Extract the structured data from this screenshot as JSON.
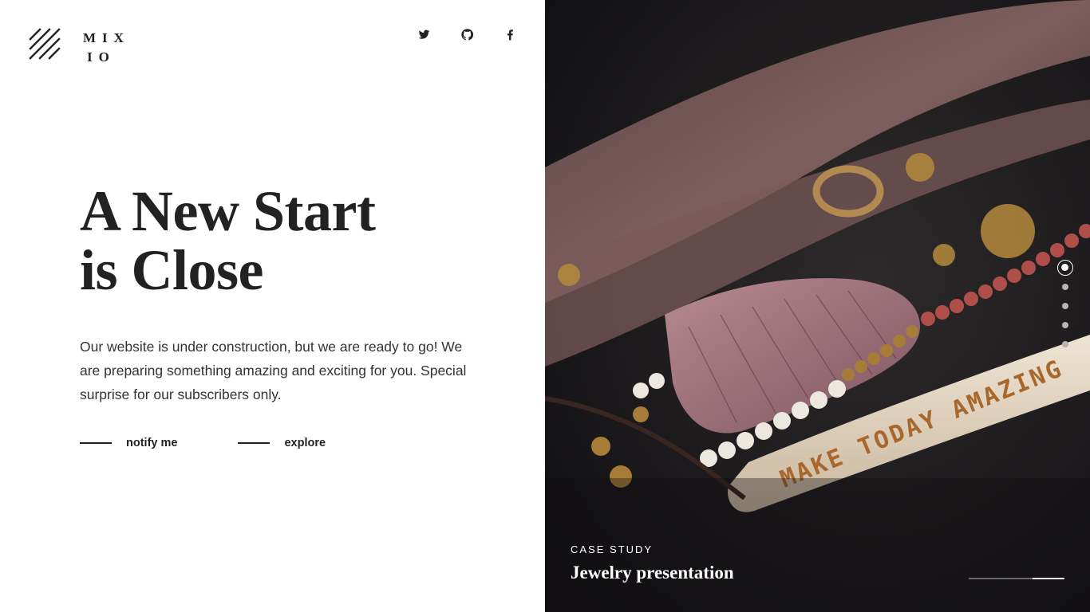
{
  "brand": {
    "logo_line1": "MIX",
    "logo_line2": "IO"
  },
  "social": [
    {
      "icon": "twitter-icon"
    },
    {
      "icon": "github-icon"
    },
    {
      "icon": "facebook-icon"
    }
  ],
  "hero": {
    "headline_line1": "A New Start",
    "headline_line2": "is Close",
    "description": "Our website is under construction, but we are ready to go! We are preparing something amazing and exciting for you. Special surprise for our subscribers only."
  },
  "actions": {
    "notify_label": "notify me",
    "explore_label": "explore"
  },
  "slider": {
    "kicker": "CASE STUDY",
    "title": "Jewelry presentation",
    "slide_count": 5,
    "active_slide": 1,
    "progress_fraction": 0.33,
    "engraving": "MAKE TODAY AMAZING"
  },
  "colors": {
    "text_dark": "#222222",
    "panel_dark": "#1b1a1c",
    "accent_white": "#ffffff"
  }
}
